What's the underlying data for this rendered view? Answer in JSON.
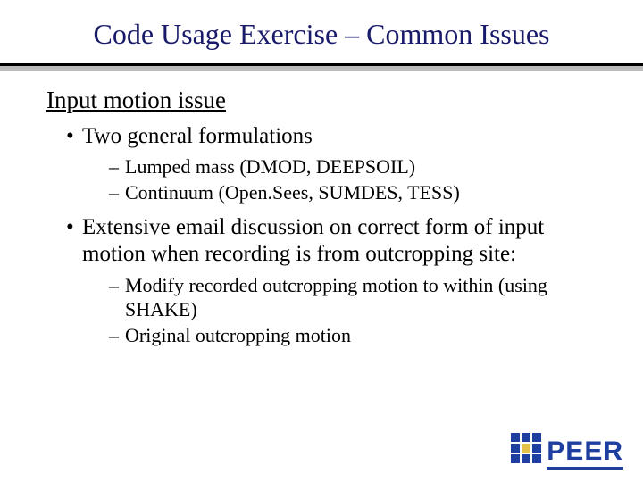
{
  "title": "Code Usage Exercise – Common Issues",
  "section_heading": "Input motion issue",
  "bullets": {
    "b1": {
      "text": "Two general formulations",
      "sub": {
        "s1": "Lumped mass (DMOD, DEEPSOIL)",
        "s2": "Continuum (Open.Sees, SUMDES, TESS)"
      }
    },
    "b2": {
      "text": "Extensive email discussion on correct form of input motion when recording is from outcropping site:",
      "sub": {
        "s1": "Modify recorded outcropping motion to within (using SHAKE)",
        "s2": "Original outcropping motion"
      }
    }
  },
  "logo": {
    "text": "PEER",
    "color": "#1e3fa0"
  }
}
